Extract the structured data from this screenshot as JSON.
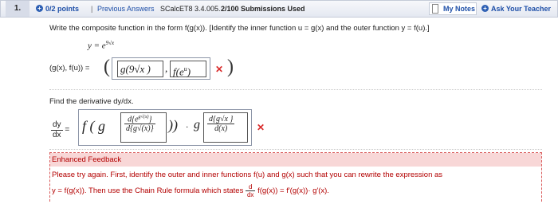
{
  "header": {
    "number": "1.",
    "points": "0/2 points",
    "separator": "|",
    "previous_answers": "Previous Answers",
    "source": "SCalcET8 3.4.005.",
    "submissions": "2/100 Submissions Used",
    "my_notes": "My Notes",
    "ask_teacher": "Ask Your Teacher"
  },
  "question": {
    "prompt": "Write the composite function in the form f(g(x)). [Identify the inner function u = g(x) and the outer function y = f(u).]",
    "equation": "y = e",
    "equation_exp": "9√x",
    "answer_label": "(g(x), f(u)) =",
    "answer_g": "g(9√x )",
    "answer_f": "f(e",
    "answer_f_exp": "u",
    "answer_f_close": ")",
    "answer_comma": ","
  },
  "derivative": {
    "prompt": "Find the derivative dy/dx.",
    "lhs_num": "dy",
    "lhs_den": "dx",
    "equals": "=",
    "expr_outer": "f ( g",
    "frac1_num": "d{e",
    "frac1_num_exp": "g√(x)",
    "frac1_num_close": "}",
    "frac1_den": "d{g√(x)}",
    "dot": "·",
    "g2": "g",
    "frac2_num": "d{g√x }",
    "frac2_den": "d(x)"
  },
  "feedback": {
    "title": "Enhanced Feedback",
    "line1": "Please try again. First, identify the outer and inner functions f(u) and g(x) such that you can rewrite the expression as",
    "line2_pre": "y = f(g(x)). Then use the Chain Rule formula which states",
    "line2_d": "d",
    "line2_dx": "dx",
    "line2_post": "f(g(x)) = f′(g(x))· g′(x)."
  },
  "colors": {
    "accent": "#1e4fa8",
    "error": "#d92b2b",
    "feedback_bg": "#f8d7d7"
  }
}
